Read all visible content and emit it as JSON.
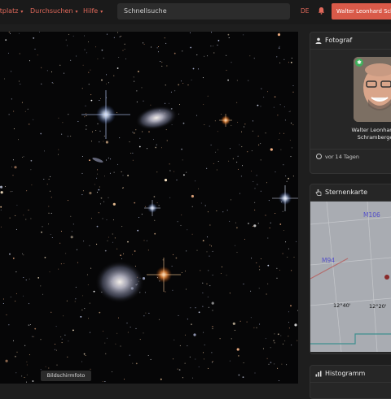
{
  "topbar": {
    "nav": [
      {
        "label": "Marktplatz"
      },
      {
        "label": "Durchsuchen"
      },
      {
        "label": "Hilfe"
      }
    ],
    "search_placeholder": "Schnellsuche",
    "language": "DE",
    "user_button": "Walter Leonhard Schramberger"
  },
  "image": {
    "screenshot_label": "Bildschirmfoto"
  },
  "sidebar": {
    "photographer": {
      "title": "Fotograf",
      "name_line1": "Walter Leonhard",
      "name_line2": "Schramberger",
      "time": "vor 14 Tagen"
    },
    "starmap": {
      "title": "Sternenkarte",
      "labels": {
        "m106": "M106",
        "m94": "M94"
      },
      "ticks": {
        "ra1": "12°40'",
        "ra2": "12°20'"
      }
    },
    "histogram": {
      "title": "Histogramm"
    }
  },
  "colors": {
    "accent": "#d95a49",
    "nav_text": "#e0685a",
    "background": "#1e1e1e",
    "card": "#262626"
  }
}
